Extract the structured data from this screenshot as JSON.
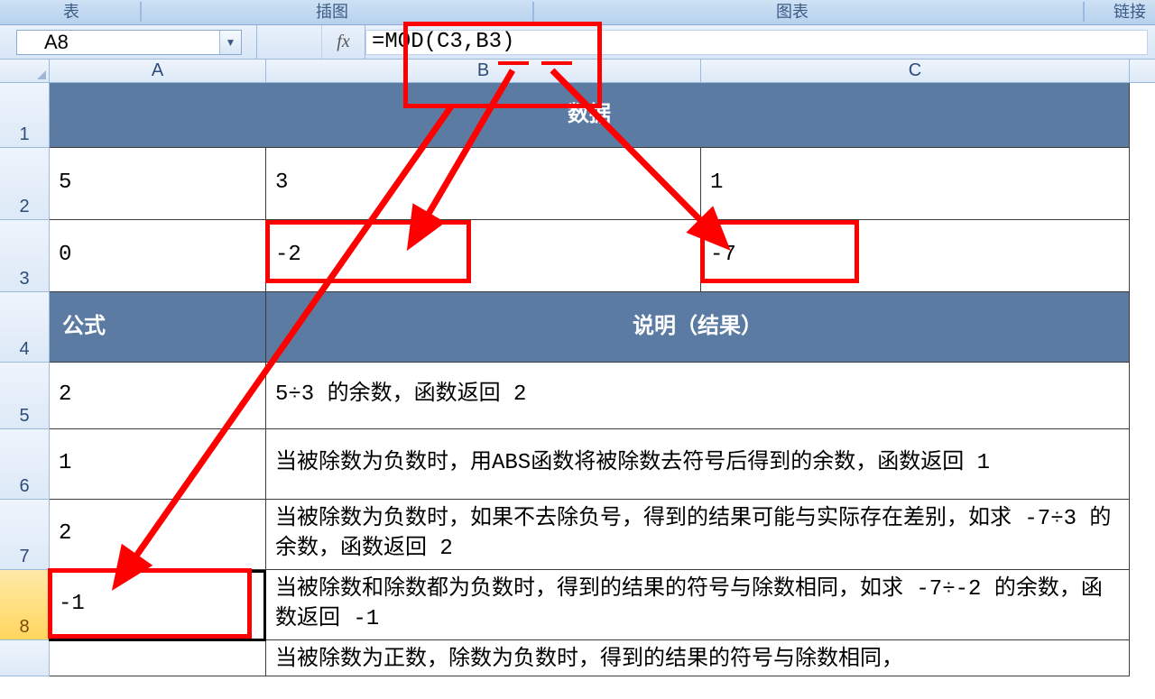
{
  "ribbon": {
    "label1": "表",
    "label2": "插图",
    "label3": "图表",
    "label4": "链接"
  },
  "formula_bar": {
    "name_box": "A8",
    "fx_label": "fx",
    "formula": "=MOD(C3,B3)"
  },
  "columns": {
    "A": "A",
    "B": "B",
    "C": "C"
  },
  "rows": {
    "r1": {
      "num": "1",
      "merged": "数据"
    },
    "r2": {
      "num": "2",
      "A": "5",
      "B": "3",
      "C": "1"
    },
    "r3": {
      "num": "3",
      "A": "0",
      "B": "-2",
      "C": "-7"
    },
    "r4": {
      "num": "4",
      "A": "公式",
      "mergedBC": "说明（结果）"
    },
    "r5": {
      "num": "5",
      "A": "2",
      "BC": "5÷3 的余数，函数返回 2"
    },
    "r6": {
      "num": "6",
      "A": "1",
      "BC": "当被除数为负数时，用ABS函数将被除数去符号后得到的余数，函数返回 1"
    },
    "r7": {
      "num": "7",
      "A": "2",
      "BC": "当被除数为负数时，如果不去除负号，得到的结果可能与实际存在差别，如求 -7÷3 的余数，函数返回 2"
    },
    "r8": {
      "num": "8",
      "A": "-1",
      "BC": "当被除数和除数都为负数时，得到的结果的符号与除数相同，如求 -7÷-2 的余数，函数返回 -1"
    },
    "r9": {
      "num": "",
      "A": "",
      "BC": "当被除数为正数，除数为负数时，得到的结果的符号与除数相同，"
    }
  }
}
